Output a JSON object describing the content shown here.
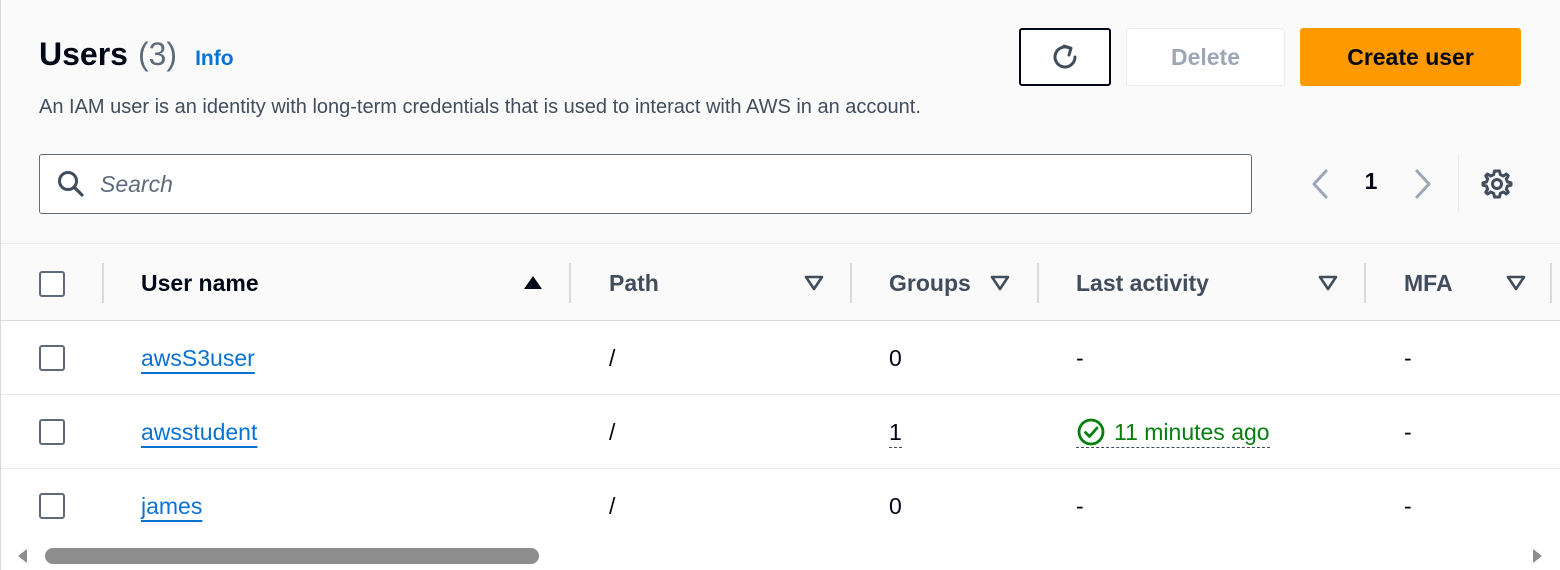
{
  "header": {
    "title": "Users",
    "count": "(3)",
    "info": "Info",
    "description": "An IAM user is an identity with long-term credentials that is used to interact with AWS in an account."
  },
  "actions": {
    "refresh_icon": "refresh-icon",
    "delete_label": "Delete",
    "create_label": "Create user"
  },
  "search": {
    "placeholder": "Search",
    "value": ""
  },
  "pagination": {
    "current_page": "1"
  },
  "table": {
    "columns": {
      "user_name": "User name",
      "path": "Path",
      "groups": "Groups",
      "last_activity": "Last activity",
      "mfa": "MFA"
    },
    "rows": [
      {
        "user_name": "awsS3user",
        "path": "/",
        "groups": "0",
        "last_activity": "-",
        "mfa": "-"
      },
      {
        "user_name": "awsstudent",
        "path": "/",
        "groups": "1",
        "last_activity": "11 minutes ago",
        "mfa": "-"
      },
      {
        "user_name": "james",
        "path": "/",
        "groups": "0",
        "last_activity": "-",
        "mfa": "-"
      }
    ]
  },
  "colors": {
    "accent_orange": "#ff9900",
    "link_blue": "#0972d3",
    "success_green": "#037f0c"
  }
}
